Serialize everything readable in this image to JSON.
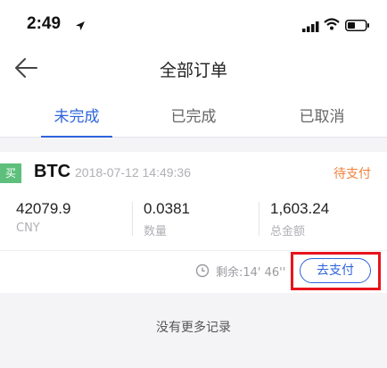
{
  "status_bar": {
    "time": "2:49",
    "icons": [
      "location-arrow-icon",
      "signal-icon",
      "wifi-icon",
      "battery-icon"
    ]
  },
  "nav": {
    "title": "全部订单",
    "back_icon": "back-arrow-icon"
  },
  "tabs": [
    {
      "label": "未完成",
      "active": true
    },
    {
      "label": "已完成",
      "active": false
    },
    {
      "label": "已取消",
      "active": false
    }
  ],
  "order": {
    "side_badge": "买",
    "coin": "BTC",
    "time": "2018-07-12 14:49:36",
    "status": "待支付",
    "columns": [
      {
        "value": "42079.9",
        "label": "CNY"
      },
      {
        "value": "0.0381",
        "label": "数量"
      },
      {
        "value": "1,603.24",
        "label": "总金额"
      }
    ],
    "countdown": "剩余:14' 46''",
    "pay_button": "去支付"
  },
  "footer": {
    "no_more": "没有更多记录"
  },
  "colors": {
    "accent": "#2d64dc",
    "pending": "#f0803c",
    "buy": "#5dbf7b",
    "highlight": "#e8141c"
  }
}
